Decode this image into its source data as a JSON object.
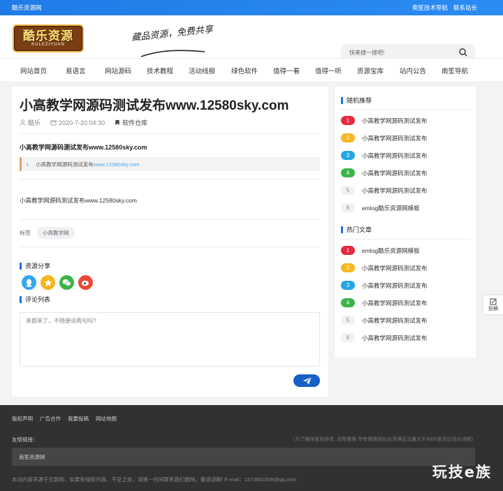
{
  "topbar": {
    "site_name": "酷乐资源网",
    "links": [
      "南笙技术导航",
      "联系站长"
    ]
  },
  "header": {
    "logo_text": "酷乐资源",
    "logo_sub": "KULEZIYUAN",
    "slogan": "藏品资源，免费共享",
    "search_placeholder": "快来搜一搜吧!"
  },
  "nav": [
    "网站首页",
    "易语言",
    "网站源码",
    "技术教程",
    "活动线报",
    "绿色软件",
    "值得一看",
    "值得一听",
    "资源宝库",
    "站内公告",
    "南笙导航"
  ],
  "article": {
    "title": "小高教学网源码测试发布www.12580sky.com",
    "author": "酷乐",
    "date": "2020-7-20 04:30",
    "category": "软件仓库",
    "heading": "小高教学网源码测试发布www.12580sky.com",
    "code_num": "1.",
    "code_text": "小高教学网源码测试发布",
    "code_link": "www.12580sky.com",
    "body": "小高教学网源码测试发布www.12580sky.com",
    "tags_label": "标签",
    "tag": "小高教学网",
    "share_title": "资源分享",
    "comments_title": "评论列表",
    "comment_placeholder": "来都来了，不随便说两句吗?"
  },
  "sidebar": {
    "random_title": "随机推荐",
    "random": [
      {
        "n": "1",
        "title": "小高教学网源码测试发布"
      },
      {
        "n": "2",
        "title": "小高教学网源码测试发布"
      },
      {
        "n": "3",
        "title": "小高教学网源码测试发布"
      },
      {
        "n": "4",
        "title": "小高教学网源码测试发布"
      },
      {
        "n": "5",
        "title": "小高教学网源码测试发布"
      },
      {
        "n": "6",
        "title": "emlog酷乐资源网模板"
      }
    ],
    "hot_title": "热门文章",
    "hot": [
      {
        "n": "1",
        "title": "emlog酷乐资源网模板"
      },
      {
        "n": "2",
        "title": "小高教学网源码测试发布"
      },
      {
        "n": "3",
        "title": "小高教学网源码测试发布"
      },
      {
        "n": "4",
        "title": "小高教学网源码测试发布"
      },
      {
        "n": "5",
        "title": "小高教学网源码测试发布"
      },
      {
        "n": "6",
        "title": "小高教学网源码测试发布"
      }
    ]
  },
  "float_button": "投稿",
  "footer": {
    "links": [
      "版权声明",
      "广告合作",
      "我要投稿",
      "网站地图"
    ],
    "friend_label": "友情链接：",
    "friend_note": "(为了确保爱和持有, 店帮着降 所有做链网站必须满足流量大于8000变否位站长谅解)",
    "friend_site": "南笙资源网",
    "copyright": "本站内容来源于互联网，如果有侵权内容、不妥之处，请第一时间联系我们删除。敬请谅解! E-mail：1573652308@qq.com",
    "watermark": "玩技e族"
  },
  "colors": {
    "primary": "#1a73e8",
    "badge1": "#e8283c",
    "badge2": "#f6b81c",
    "badge3": "#21a7e3",
    "badge4": "#3ab549",
    "footer_bg": "#313131"
  }
}
